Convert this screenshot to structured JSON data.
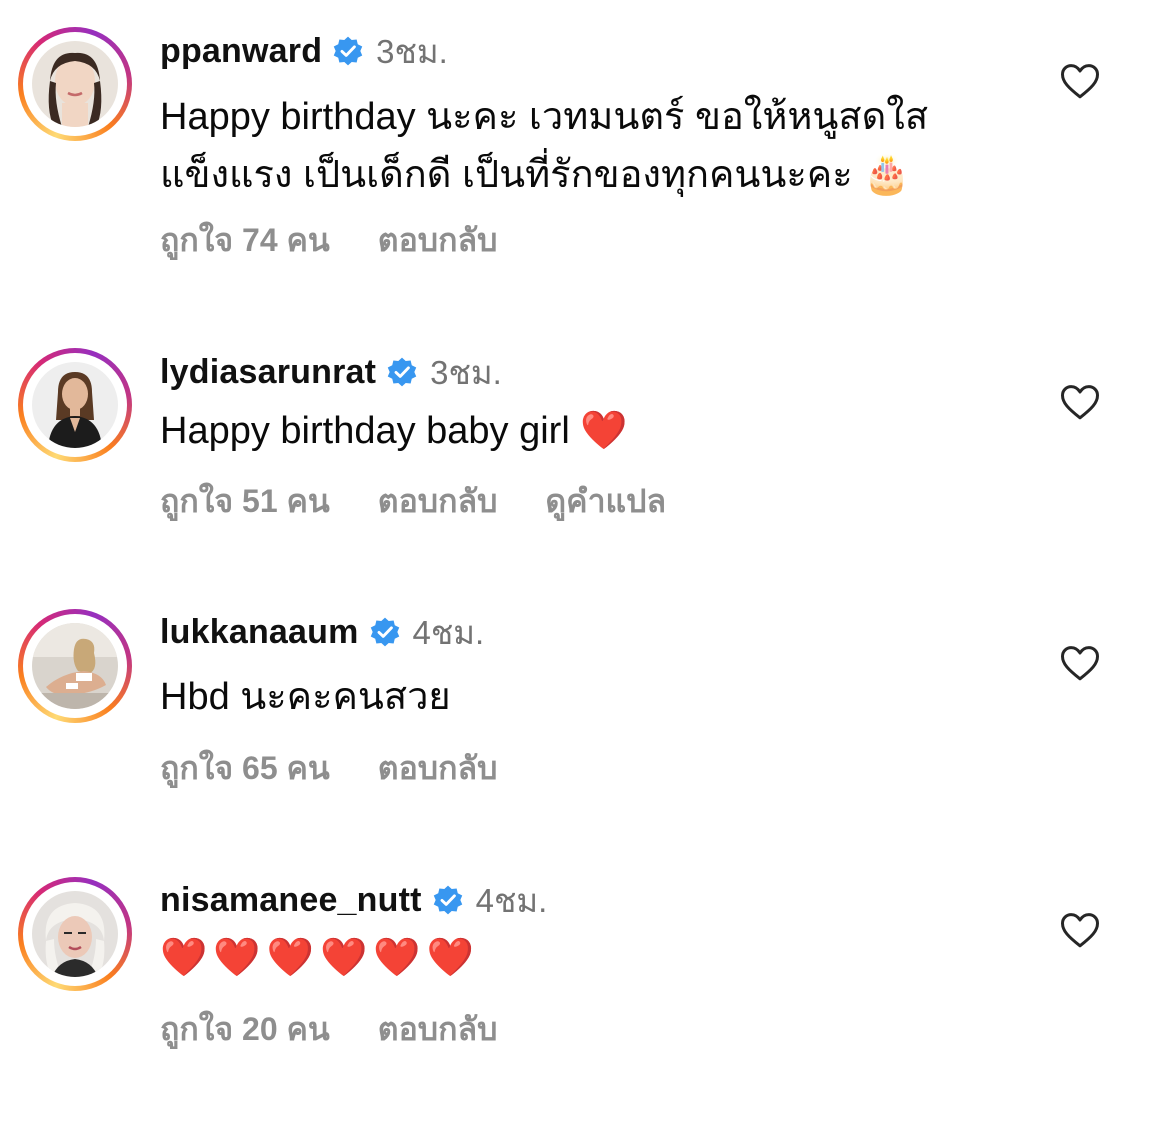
{
  "comments": [
    {
      "username": "ppanward",
      "time": "3ชม.",
      "text": "Happy birthday นะคะ เวทมนตร์ ขอให้หนูสดใส\nแข็งแรง เป็นเด็กดี เป็นที่รักของทุกคนนะคะ 🎂",
      "likes": "ถูกใจ 74 คน",
      "reply": "ตอบกลับ",
      "translate": ""
    },
    {
      "username": "lydiasarunrat",
      "time": "3ชม.",
      "text": "Happy birthday baby girl ❤️",
      "likes": "ถูกใจ 51 คน",
      "reply": "ตอบกลับ",
      "translate": "ดูคำแปล"
    },
    {
      "username": "lukkanaaum",
      "time": "4ชม.",
      "text": "Hbd นะคะคนสวย",
      "likes": "ถูกใจ 65 คน",
      "reply": "ตอบกลับ",
      "translate": ""
    },
    {
      "username": "nisamanee_nutt",
      "time": "4ชม.",
      "text": "❤️❤️❤️❤️❤️❤️",
      "likes": "ถูกใจ 20 คน",
      "reply": "ตอบกลับ",
      "translate": ""
    }
  ],
  "icons": {
    "verified": "verified-badge-icon",
    "like": "heart-outline-icon"
  },
  "colors": {
    "verified_blue": "#3897f0",
    "meta_gray": "#8e8e8e",
    "time_gray": "#737373"
  }
}
